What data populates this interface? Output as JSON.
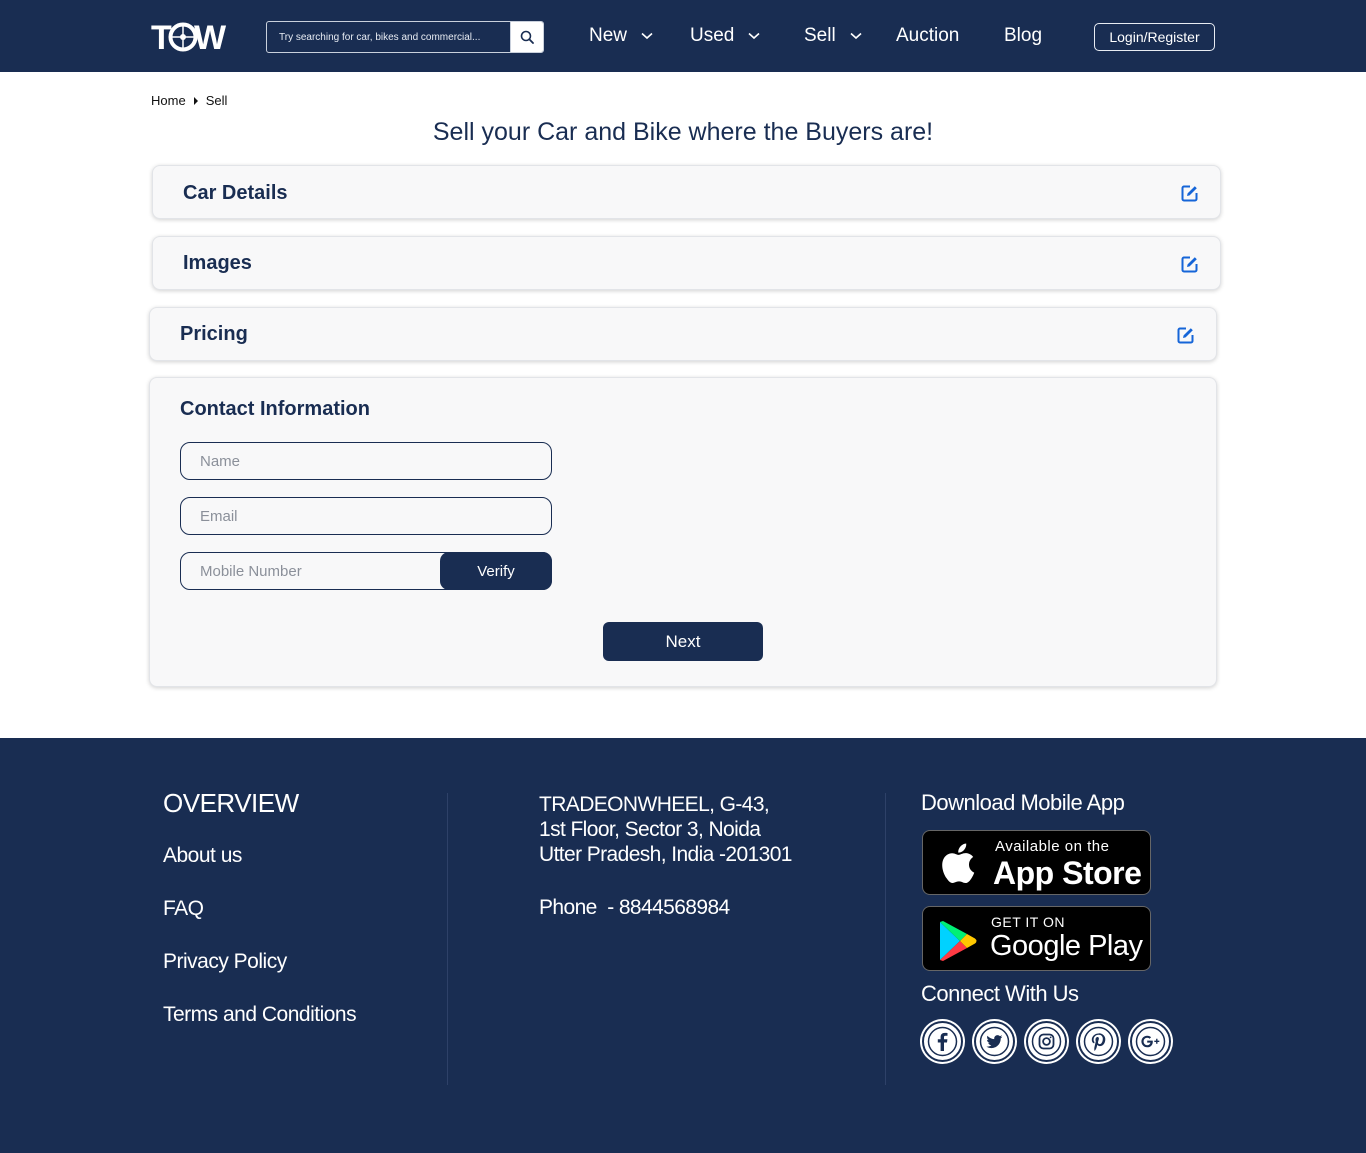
{
  "header": {
    "logo_text": "TOW",
    "search": {
      "placeholder": "Try searching for car, bikes and commercial..."
    },
    "nav": [
      {
        "label": "New"
      },
      {
        "label": "Used"
      },
      {
        "label": "Sell"
      },
      {
        "label": "Auction"
      },
      {
        "label": "Blog"
      }
    ],
    "login_label": "Login/Register"
  },
  "breadcrumb": {
    "home": "Home",
    "current": "Sell"
  },
  "page_title": "Sell your Car and Bike where the Buyers are!",
  "sections": {
    "car_details": "Car Details",
    "images": "Images",
    "pricing": "Pricing",
    "contact": "Contact Information"
  },
  "form": {
    "name_placeholder": "Name",
    "email_placeholder": "Email",
    "mobile_placeholder": "Mobile Number",
    "verify_label": "Verify",
    "next_label": "Next"
  },
  "footer": {
    "overview_heading": "OVERVIEW",
    "links": [
      "About us",
      "FAQ",
      "Privacy Policy",
      "Terms and Conditions"
    ],
    "address_lines": [
      "TRADEONWHEEL, G-43,",
      "1st Floor, Sector 3, Noida",
      "Utter Pradesh, India -201301"
    ],
    "phone": "Phone  - 8844568984",
    "download_heading": "Download Mobile App",
    "app_store": {
      "small": "Available on the",
      "big": "App Store"
    },
    "google_play": {
      "small": "GET IT ON",
      "big": "Google Play"
    },
    "connect_heading": "Connect With Us"
  },
  "colors": {
    "brand_navy": "#192d52",
    "edit_blue": "#1565d8"
  },
  "icons": [
    "search-icon",
    "chevron-down-icon",
    "edit-icon",
    "apple-icon",
    "google-play-icon",
    "facebook-icon",
    "twitter-icon",
    "instagram-icon",
    "pinterest-icon",
    "google-plus-icon"
  ]
}
